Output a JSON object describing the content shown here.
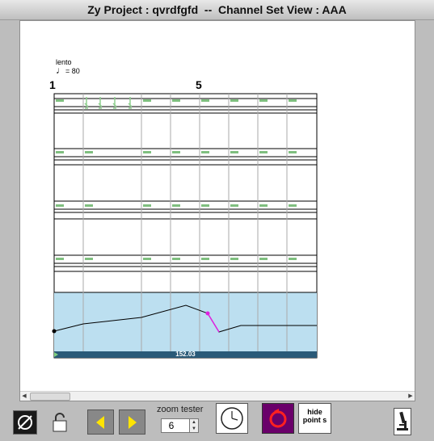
{
  "window": {
    "title": "Zy Project : qvrdfgfd  --  Channel Set View : AAA"
  },
  "score": {
    "tempo_marking": "lento",
    "tempo_value": "= 80",
    "measure_numbers": [
      "1",
      "5"
    ]
  },
  "automation": {
    "value_label": "152.03"
  },
  "toolbar": {
    "zoom_label": "zoom tester",
    "zoom_value": "6",
    "hide_points_label": "hide point s"
  },
  "colors": {
    "rest_green": "#7fbf7f",
    "note_green": "#8fcf8f",
    "automation_bg": "#bcdff0",
    "automation_bar": "#2a5a78",
    "selected_point": "#e020e0",
    "toolbar_bg": "#bdbdbd",
    "arrow_yellow": "#ffe400",
    "purple_button": "#6a006a"
  },
  "icons": {
    "null": "null-icon",
    "lock": "lock-icon",
    "prev": "left-arrow-icon",
    "next": "right-arrow-icon",
    "clock": "clock-icon",
    "record": "record-icon",
    "microscope": "microscope-icon"
  }
}
